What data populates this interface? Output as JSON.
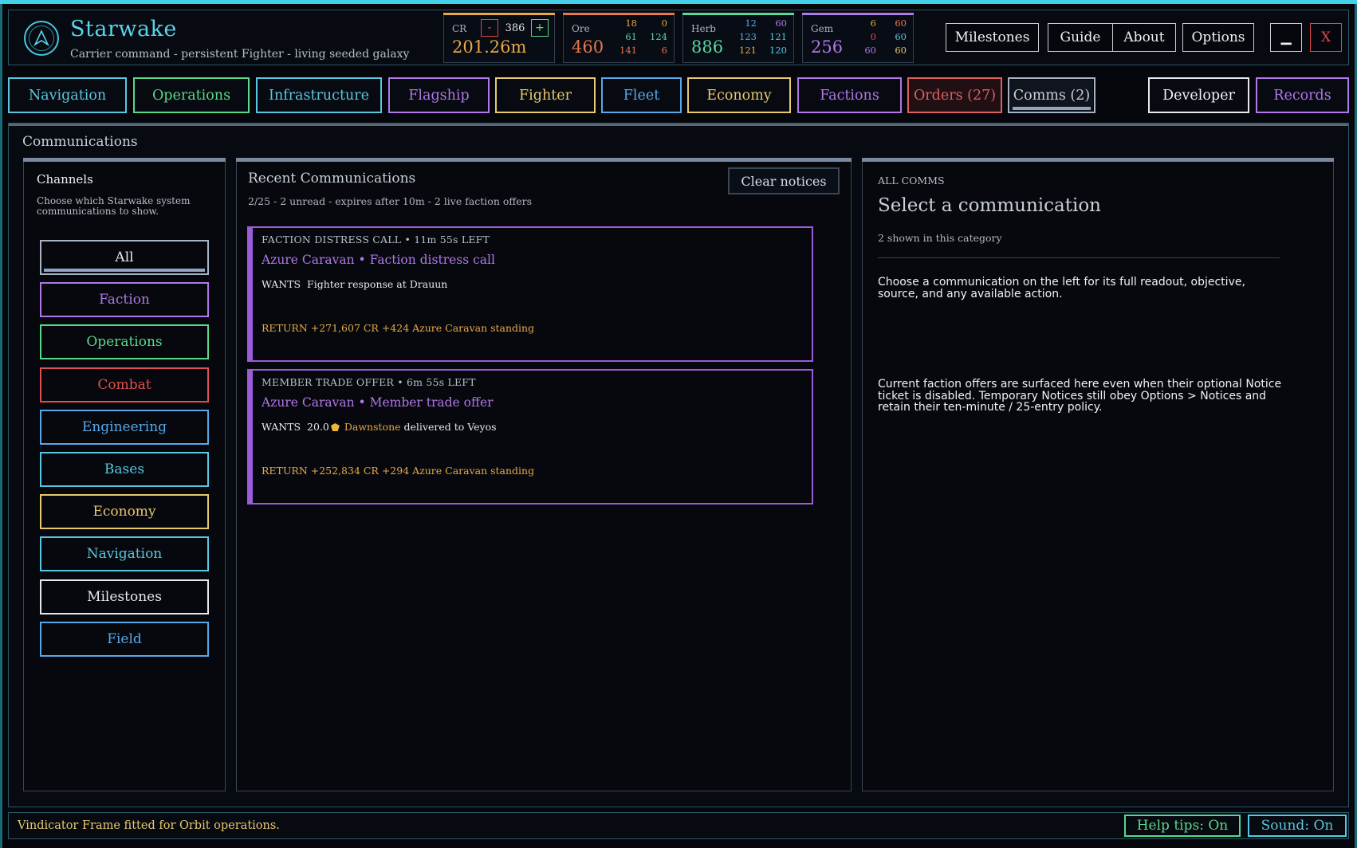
{
  "app": {
    "title": "Starwake",
    "subtitle": "Carrier command - persistent Fighter - living seeded galaxy",
    "logo_icon": "ring-emblem-icon"
  },
  "resources": {
    "cr": {
      "label": "CR",
      "stepper_value": "386",
      "minus": "-",
      "plus": "+",
      "total": "201.26m",
      "color": "#e8a848"
    },
    "ore": {
      "label": "Ore",
      "total": "460",
      "color": "#e8784a",
      "mini": [
        "18",
        "0",
        "61",
        "124",
        "141",
        "6"
      ]
    },
    "herb": {
      "label": "Herb",
      "total": "886",
      "color": "#5ad8a0",
      "mini": [
        "12",
        "60",
        "123",
        "121",
        "121",
        "120"
      ]
    },
    "gem": {
      "label": "Gem",
      "total": "256",
      "color": "#b078e8",
      "mini": [
        "6",
        "60",
        "0",
        "60",
        "60",
        "60"
      ]
    }
  },
  "header_buttons": {
    "milestones": "Milestones",
    "guide": "Guide",
    "about": "About",
    "options": "Options",
    "minimize": "▁",
    "close": "X"
  },
  "tabs": {
    "navigation": "Navigation",
    "operations": "Operations",
    "infrastructure": "Infrastructure",
    "flagship": "Flagship",
    "fighter": "Fighter",
    "fleet": "Fleet",
    "economy": "Economy",
    "factions": "Factions",
    "orders": "Orders (27)",
    "comms": "Comms (2)",
    "developer": "Developer",
    "records": "Records"
  },
  "main": {
    "title": "Communications"
  },
  "channels": {
    "title": "Channels",
    "description": "Choose which Starwake system communications to show.",
    "items": {
      "all": "All",
      "faction": "Faction",
      "operations": "Operations",
      "combat": "Combat",
      "engineering": "Engineering",
      "bases": "Bases",
      "economy": "Economy",
      "navigation": "Navigation",
      "milestones": "Milestones",
      "field": "Field"
    }
  },
  "recent": {
    "title": "Recent Communications",
    "summary": "2/25 - 2 unread - expires after 10m - 2 live faction offers",
    "clear_label": "Clear notices",
    "cards": [
      {
        "tag": "FACTION DISTRESS CALL • 11m 55s LEFT",
        "heading": "Azure Caravan • Faction distress call",
        "wants_label": "WANTS",
        "wants_text": "Fighter response at Drauun",
        "return_text": "RETURN  +271,607 CR  +424 Azure Caravan standing"
      },
      {
        "tag": "MEMBER TRADE OFFER • 6m 55s LEFT",
        "heading": "Azure Caravan • Member trade offer",
        "wants_label": "WANTS",
        "wants_amount": "20.0",
        "wants_item": "Dawnstone",
        "wants_rest": "delivered to Veyos",
        "return_text": "RETURN  +252,834 CR  +294 Azure Caravan standing"
      }
    ]
  },
  "detail": {
    "tag": "ALL COMMS",
    "title": "Select a communication",
    "count": "2 shown in this category",
    "para1": "Choose a communication on the left for its full readout, objective, source, and any available action.",
    "para2": "Current faction offers are surfaced here even when their optional Notice ticket is disabled. Temporary Notices still obey Options > Notices and retain their ten-minute / 25-entry policy."
  },
  "status": {
    "message": "Vindicator Frame fitted for Orbit operations.",
    "help_tips": "Help tips: On",
    "sound": "Sound: On"
  }
}
